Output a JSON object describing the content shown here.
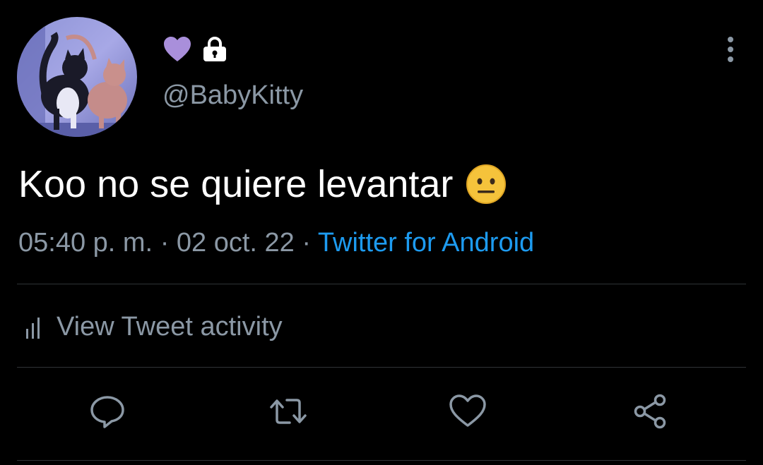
{
  "author": {
    "handle": "@BabyKitty",
    "emoji_badge": "purple-heart",
    "protected_icon": "lock-icon",
    "avatar": "avatar"
  },
  "tweet": {
    "text": "Koo no se quiere levantar",
    "emoji": "neutral-face",
    "time": "05:40 p. m.",
    "separator": "·",
    "date": "02 oct. 22",
    "source": "Twitter for Android"
  },
  "activity": {
    "label": "View Tweet activity",
    "icon": "bar-chart-icon"
  },
  "actions": {
    "reply": "reply-icon",
    "retweet": "retweet-icon",
    "like": "heart-icon",
    "share": "share-icon"
  },
  "colors": {
    "background": "#000000",
    "text_primary": "#ffffff",
    "text_secondary": "#8b98a5",
    "link": "#1d9bf0",
    "divider": "#2f3336",
    "heart_badge": "#a98fdb"
  }
}
